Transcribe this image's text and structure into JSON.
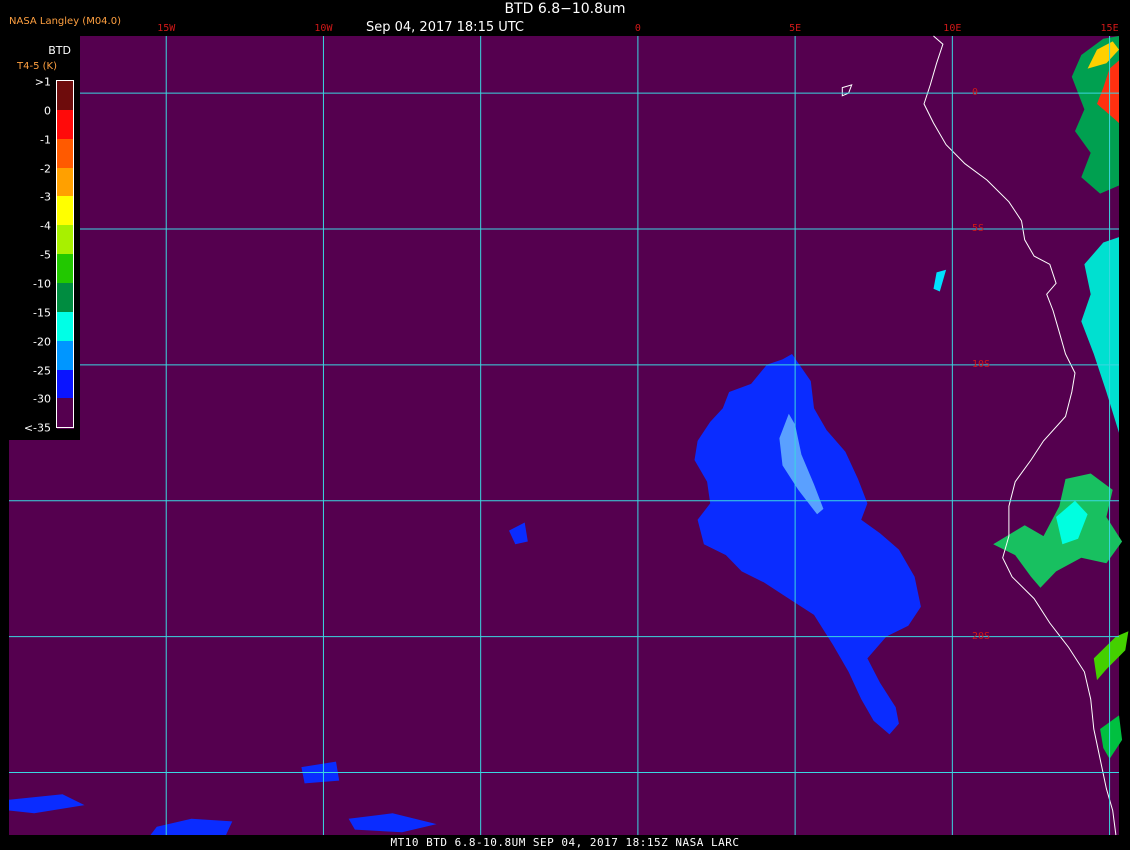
{
  "header": {
    "title": "BTD 6.8−10.8um",
    "subtitle": "Sep 04, 2017 18:15 UTC",
    "agency": "NASA Langley (M04.0)"
  },
  "footer": {
    "text": "MT10  BTD 6.8-10.8UM  SEP 04, 2017 18:15Z  NASA LARC"
  },
  "map": {
    "background": "#55004f",
    "grid_color": "#3ad7e0",
    "coast_color": "#ffffff",
    "label_color": "#d01818",
    "lon_range": [
      -20,
      15.3
    ],
    "lat_range": [
      2.1,
      -27.3
    ],
    "lon_lines": [
      {
        "lon": -15,
        "label": "15W"
      },
      {
        "lon": -10,
        "label": "10W"
      },
      {
        "lon": -5,
        "label": ""
      },
      {
        "lon": 0,
        "label": "0"
      },
      {
        "lon": 5,
        "label": "5E"
      },
      {
        "lon": 10,
        "label": "10E"
      },
      {
        "lon": 15,
        "label": "15E"
      }
    ],
    "lat_lines": [
      {
        "lat": 0,
        "label": "0"
      },
      {
        "lat": -5,
        "label": "5S"
      },
      {
        "lat": -10,
        "label": "10S"
      },
      {
        "lat": -15,
        "label": ""
      },
      {
        "lat": -20,
        "label": "20S"
      },
      {
        "lat": -25,
        "label": ""
      }
    ],
    "coastline": [
      [
        9.4,
        2.1
      ],
      [
        9.7,
        1.8
      ],
      [
        9.5,
        1.1
      ],
      [
        9.3,
        0.3
      ],
      [
        9.1,
        -0.4
      ],
      [
        9.4,
        -1.1
      ],
      [
        9.8,
        -1.9
      ],
      [
        10.4,
        -2.6
      ],
      [
        11.1,
        -3.2
      ],
      [
        11.8,
        -4.0
      ],
      [
        12.2,
        -4.7
      ],
      [
        12.3,
        -5.4
      ],
      [
        12.6,
        -6.0
      ],
      [
        13.1,
        -6.3
      ],
      [
        13.3,
        -7.0
      ],
      [
        13.0,
        -7.4
      ],
      [
        13.2,
        -8.0
      ],
      [
        13.4,
        -8.8
      ],
      [
        13.6,
        -9.6
      ],
      [
        13.9,
        -10.3
      ],
      [
        13.8,
        -11.0
      ],
      [
        13.6,
        -11.9
      ],
      [
        12.9,
        -12.8
      ],
      [
        12.5,
        -13.5
      ],
      [
        12.0,
        -14.3
      ],
      [
        11.8,
        -15.2
      ],
      [
        11.8,
        -16.3
      ],
      [
        11.6,
        -17.1
      ],
      [
        11.9,
        -17.8
      ],
      [
        12.6,
        -18.6
      ],
      [
        13.1,
        -19.5
      ],
      [
        13.7,
        -20.4
      ],
      [
        14.2,
        -21.3
      ],
      [
        14.4,
        -22.3
      ],
      [
        14.5,
        -23.4
      ],
      [
        14.7,
        -24.5
      ],
      [
        14.9,
        -25.6
      ],
      [
        15.1,
        -26.4
      ],
      [
        15.2,
        -27.3
      ]
    ],
    "island": [
      [
        6.5,
        0.2
      ],
      [
        6.8,
        0.3
      ],
      [
        6.7,
        0.0
      ],
      [
        6.5,
        -0.1
      ]
    ]
  },
  "legend": {
    "title": "BTD",
    "units": "T4-5 (K)",
    "entries": [
      {
        "label": ">1",
        "color": "#6e0c0c"
      },
      {
        "label": "0",
        "color": "#ff0a0a"
      },
      {
        "label": "-1",
        "color": "#ff5a00"
      },
      {
        "label": "-2",
        "color": "#ffa000"
      },
      {
        "label": "-3",
        "color": "#ffff00"
      },
      {
        "label": "-4",
        "color": "#a8f000"
      },
      {
        "label": "-5",
        "color": "#22c800"
      },
      {
        "label": "-10",
        "color": "#008c40"
      },
      {
        "label": "-15",
        "color": "#00ffe6"
      },
      {
        "label": "-20",
        "color": "#0096ff"
      },
      {
        "label": "-25",
        "color": "#0a14ff"
      },
      {
        "label": "-30",
        "color": "#55004f"
      },
      {
        "label": "<-35",
        "color": "#55004f"
      }
    ]
  },
  "data_features": [
    {
      "name": "plume-main",
      "color": "#0a2cff",
      "polygon": [
        [
          4.9,
          -9.6
        ],
        [
          4.6,
          -9.8
        ],
        [
          4.1,
          -10.0
        ],
        [
          3.6,
          -10.7
        ],
        [
          2.9,
          -11.0
        ],
        [
          2.7,
          -11.6
        ],
        [
          2.3,
          -12.1
        ],
        [
          1.9,
          -12.8
        ],
        [
          1.8,
          -13.5
        ],
        [
          2.2,
          -14.3
        ],
        [
          2.3,
          -15.1
        ],
        [
          1.9,
          -15.7
        ],
        [
          2.1,
          -16.6
        ],
        [
          2.8,
          -17.0
        ],
        [
          3.3,
          -17.6
        ],
        [
          4.0,
          -18.0
        ],
        [
          4.8,
          -18.6
        ],
        [
          5.6,
          -19.2
        ],
        [
          6.2,
          -20.3
        ],
        [
          6.7,
          -21.3
        ],
        [
          7.1,
          -22.3
        ],
        [
          7.5,
          -23.1
        ],
        [
          8.0,
          -23.6
        ],
        [
          8.3,
          -23.2
        ],
        [
          8.2,
          -22.6
        ],
        [
          7.7,
          -21.7
        ],
        [
          7.3,
          -20.8
        ],
        [
          7.9,
          -20.0
        ],
        [
          8.6,
          -19.6
        ],
        [
          9.0,
          -18.9
        ],
        [
          8.8,
          -17.8
        ],
        [
          8.3,
          -16.8
        ],
        [
          7.7,
          -16.2
        ],
        [
          7.1,
          -15.7
        ],
        [
          7.3,
          -15.1
        ],
        [
          7.0,
          -14.2
        ],
        [
          6.6,
          -13.2
        ],
        [
          6.0,
          -12.4
        ],
        [
          5.6,
          -11.6
        ],
        [
          5.5,
          -10.6
        ]
      ]
    },
    {
      "name": "plume-core",
      "color": "#5aa0ff",
      "polygon": [
        [
          4.8,
          -11.8
        ],
        [
          4.5,
          -12.7
        ],
        [
          4.6,
          -13.7
        ],
        [
          5.1,
          -14.6
        ],
        [
          5.7,
          -15.5
        ],
        [
          5.9,
          -15.3
        ],
        [
          5.6,
          -14.4
        ],
        [
          5.2,
          -13.3
        ],
        [
          5.0,
          -12.2
        ]
      ]
    },
    {
      "name": "cloud-northeast",
      "color": "#00a050",
      "polygon": [
        [
          13.8,
          0.6
        ],
        [
          14.1,
          1.4
        ],
        [
          14.8,
          2.0
        ],
        [
          15.3,
          2.1
        ],
        [
          15.3,
          -3.4
        ],
        [
          14.7,
          -3.7
        ],
        [
          14.1,
          -3.1
        ],
        [
          14.4,
          -2.2
        ],
        [
          13.9,
          -1.4
        ],
        [
          14.2,
          -0.6
        ]
      ]
    },
    {
      "name": "cloud-northeast-warm",
      "color": "#ff3010",
      "polygon": [
        [
          14.8,
          0.2
        ],
        [
          15.0,
          0.9
        ],
        [
          15.3,
          1.2
        ],
        [
          15.3,
          -1.1
        ],
        [
          15.0,
          -0.8
        ],
        [
          14.6,
          -0.4
        ]
      ]
    },
    {
      "name": "cloud-northeast-hot",
      "color": "#ffd000",
      "polygon": [
        [
          14.3,
          0.9
        ],
        [
          14.6,
          1.6
        ],
        [
          15.1,
          1.9
        ],
        [
          15.3,
          1.6
        ],
        [
          14.9,
          1.1
        ]
      ]
    },
    {
      "name": "cloud-east-mid",
      "color": "#00e0d0",
      "polygon": [
        [
          14.2,
          -6.3
        ],
        [
          14.8,
          -5.5
        ],
        [
          15.3,
          -5.3
        ],
        [
          15.3,
          -12.5
        ],
        [
          14.9,
          -11.0
        ],
        [
          14.5,
          -9.6
        ],
        [
          14.1,
          -8.4
        ],
        [
          14.4,
          -7.4
        ]
      ]
    },
    {
      "name": "cloud-angola-coast",
      "color": "#18c060",
      "polygon": [
        [
          11.3,
          -16.6
        ],
        [
          12.3,
          -15.9
        ],
        [
          12.9,
          -16.3
        ],
        [
          13.4,
          -15.2
        ],
        [
          13.6,
          -14.2
        ],
        [
          14.4,
          -14.0
        ],
        [
          15.1,
          -14.6
        ],
        [
          14.9,
          -15.6
        ],
        [
          15.4,
          -16.5
        ],
        [
          14.9,
          -17.3
        ],
        [
          14.1,
          -17.1
        ],
        [
          13.3,
          -17.6
        ],
        [
          12.8,
          -18.2
        ],
        [
          12.5,
          -17.8
        ],
        [
          12.0,
          -17.0
        ]
      ]
    },
    {
      "name": "cloud-angola-inner",
      "color": "#00ffe0",
      "polygon": [
        [
          13.3,
          -15.6
        ],
        [
          13.9,
          -15.0
        ],
        [
          14.3,
          -15.5
        ],
        [
          14.0,
          -16.4
        ],
        [
          13.5,
          -16.6
        ]
      ]
    },
    {
      "name": "cloud-namibia-1",
      "color": "#44d000",
      "polygon": [
        [
          14.5,
          -20.8
        ],
        [
          15.2,
          -20.0
        ],
        [
          15.6,
          -19.8
        ],
        [
          15.5,
          -20.5
        ],
        [
          14.9,
          -21.2
        ],
        [
          14.6,
          -21.6
        ]
      ]
    },
    {
      "name": "cloud-namibia-2",
      "color": "#00c040",
      "polygon": [
        [
          14.7,
          -23.4
        ],
        [
          15.3,
          -22.9
        ],
        [
          15.4,
          -23.8
        ],
        [
          15.0,
          -24.5
        ],
        [
          14.8,
          -24.1
        ]
      ]
    },
    {
      "name": "cloud-small-1",
      "color": "#0a2cff",
      "polygon": [
        [
          -4.1,
          -16.1
        ],
        [
          -3.6,
          -15.8
        ],
        [
          -3.5,
          -16.5
        ],
        [
          -3.9,
          -16.6
        ]
      ]
    },
    {
      "name": "cloud-small-2",
      "color": "#00e0ff",
      "polygon": [
        [
          9.5,
          -6.6
        ],
        [
          9.8,
          -6.5
        ],
        [
          9.6,
          -7.3
        ],
        [
          9.4,
          -7.2
        ]
      ]
    },
    {
      "name": "cloud-south-1",
      "color": "#0a2cff",
      "polygon": [
        [
          -10.7,
          -24.8
        ],
        [
          -9.6,
          -24.6
        ],
        [
          -9.5,
          -25.3
        ],
        [
          -10.6,
          -25.4
        ]
      ]
    },
    {
      "name": "cloud-south-2",
      "color": "#0a2cff",
      "polygon": [
        [
          -15.3,
          -27.0
        ],
        [
          -14.2,
          -26.7
        ],
        [
          -12.9,
          -26.8
        ],
        [
          -13.1,
          -27.3
        ],
        [
          -15.5,
          -27.3
        ]
      ]
    },
    {
      "name": "cloud-south-3",
      "color": "#0a2cff",
      "polygon": [
        [
          -9.2,
          -26.7
        ],
        [
          -7.8,
          -26.5
        ],
        [
          -6.4,
          -26.9
        ],
        [
          -7.5,
          -27.2
        ],
        [
          -9.0,
          -27.1
        ]
      ]
    },
    {
      "name": "cloud-south-4",
      "color": "#0a2cff",
      "polygon": [
        [
          -20,
          -26.0
        ],
        [
          -18.3,
          -25.8
        ],
        [
          -17.6,
          -26.2
        ],
        [
          -19.2,
          -26.5
        ],
        [
          -20,
          -26.4
        ]
      ]
    }
  ]
}
